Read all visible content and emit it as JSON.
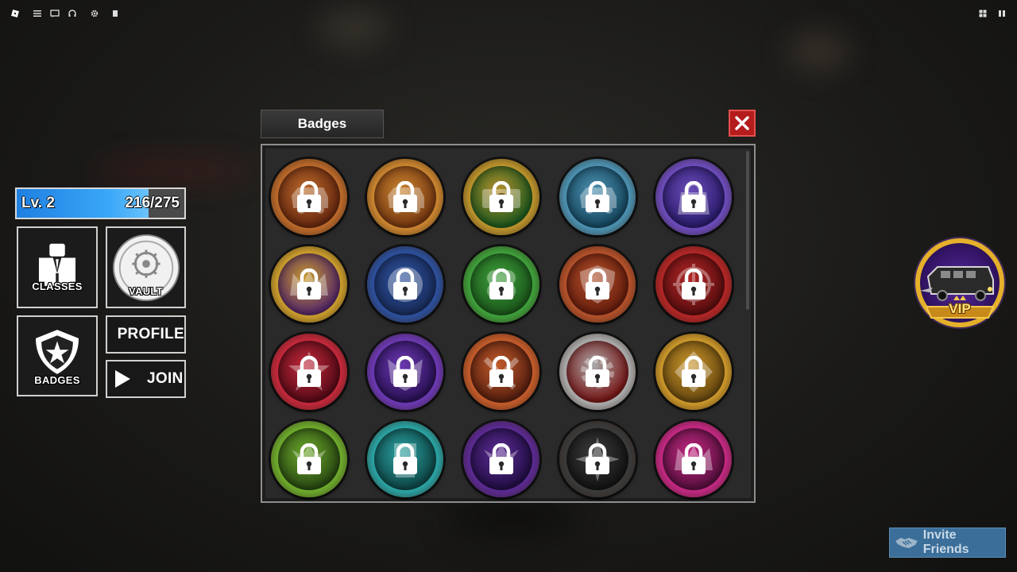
{
  "window": {
    "title": "Badges",
    "close_label": "Close"
  },
  "hud": {
    "level_label": "Lv. 2",
    "xp_text": "216/275",
    "xp_fraction": 0.785,
    "classes_label": "CLASSES",
    "vault_label": "VAULT",
    "badges_label": "BADGES",
    "profile_label": "PROFILE",
    "join_label": "JOIN"
  },
  "vip_label": "VIP",
  "invite_label": "Invite Friends",
  "badges": [
    {
      "id": "badge-1",
      "locked": true,
      "ring": "#b8682a",
      "fill": "#6b2a10",
      "glyph": "bus-icon"
    },
    {
      "id": "badge-2",
      "locked": true,
      "ring": "#c7832f",
      "fill": "#7a3a12",
      "glyph": "bus-icon"
    },
    {
      "id": "badge-3",
      "locked": true,
      "ring": "#b8902c",
      "fill": "#1f5a1e",
      "glyph": "money-icon"
    },
    {
      "id": "badge-4",
      "locked": true,
      "ring": "#4b8fae",
      "fill": "#174a63",
      "glyph": "bus-icon"
    },
    {
      "id": "badge-5",
      "locked": true,
      "ring": "#6a4bb8",
      "fill": "#2c1d6e",
      "glyph": "bag-icon"
    },
    {
      "id": "badge-6",
      "locked": true,
      "ring": "#c69a2c",
      "fill": "#5a2a6a",
      "glyph": "crown-icon"
    },
    {
      "id": "badge-7",
      "locked": true,
      "ring": "#2c4f9a",
      "fill": "#1b2f60",
      "glyph": "globe-icon"
    },
    {
      "id": "badge-8",
      "locked": true,
      "ring": "#3e9d3a",
      "fill": "#1c5a1c",
      "glyph": "clover-icon"
    },
    {
      "id": "badge-9",
      "locked": true,
      "ring": "#b0502a",
      "fill": "#6a1e0e",
      "glyph": "shield-icon"
    },
    {
      "id": "badge-10",
      "locked": true,
      "ring": "#b02626",
      "fill": "#5e0e10",
      "glyph": "crosshair-icon"
    },
    {
      "id": "badge-11",
      "locked": true,
      "ring": "#c0283a",
      "fill": "#5a0b18",
      "glyph": "star-icon"
    },
    {
      "id": "badge-12",
      "locked": true,
      "ring": "#6a38b0",
      "fill": "#2c1258",
      "glyph": "mask-icon"
    },
    {
      "id": "badge-13",
      "locked": true,
      "ring": "#c05a2a",
      "fill": "#5a2010",
      "glyph": "tools-icon"
    },
    {
      "id": "badge-14",
      "locked": true,
      "ring": "#a8a8a8",
      "fill": "#7a1818",
      "glyph": "gear-icon"
    },
    {
      "id": "badge-15",
      "locked": true,
      "ring": "#c8952a",
      "fill": "#6a4a10",
      "glyph": "diamond-icon"
    },
    {
      "id": "badge-16",
      "locked": true,
      "ring": "#6ca82c",
      "fill": "#2a4a12",
      "glyph": "wings-icon"
    },
    {
      "id": "badge-17",
      "locked": true,
      "ring": "#2aa0a0",
      "fill": "#0f4848",
      "glyph": "trophy-icon"
    },
    {
      "id": "badge-18",
      "locked": true,
      "ring": "#5a2a90",
      "fill": "#240f48",
      "glyph": "wings-icon"
    },
    {
      "id": "badge-19",
      "locked": true,
      "ring": "#3a3a3a",
      "fill": "#151515",
      "glyph": "compass-icon"
    },
    {
      "id": "badge-20",
      "locked": true,
      "ring": "#c02880",
      "fill": "#5a1040",
      "glyph": "crown-icon"
    }
  ]
}
